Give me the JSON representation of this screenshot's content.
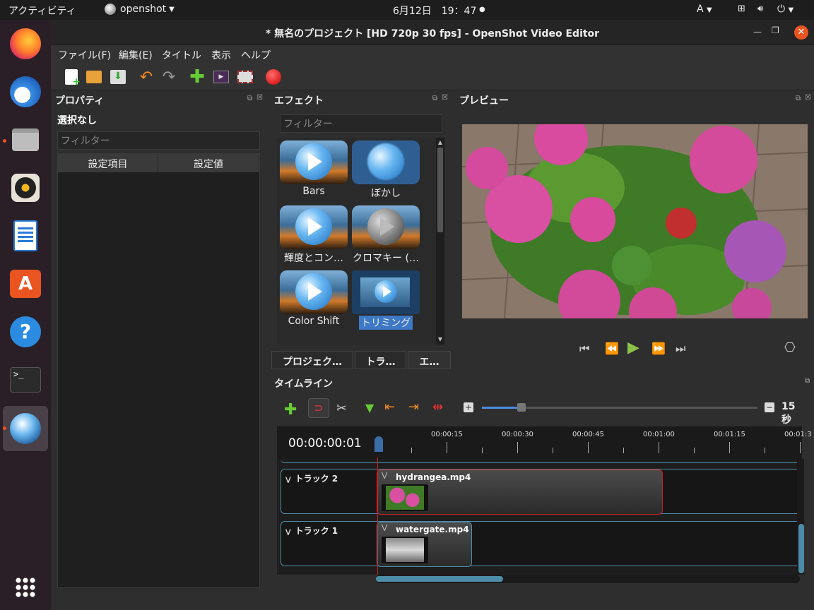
{
  "topbar": {
    "activities": "アクティビティ",
    "app": "openshot",
    "clock": "6月12日　19：47",
    "input_method": "A"
  },
  "window": {
    "title": "* 無名のプロジェクト [HD 720p 30 fps] - OpenShot Video Editor"
  },
  "menu": [
    "ファイル(F)",
    "編集(E)",
    "タイトル",
    "表示",
    "ヘルプ"
  ],
  "properties": {
    "title": "プロパティ",
    "selection": "選択なし",
    "filter_placeholder": "フィルター",
    "col_key": "設定項目",
    "col_value": "設定値"
  },
  "effects": {
    "title": "エフェクト",
    "filter_placeholder": "フィルター",
    "items": [
      "Bars",
      "ぼかし",
      "輝度とコン…",
      "クロマキー (…",
      "Color Shift",
      "トリミング"
    ]
  },
  "tabs": [
    "プロジェク…",
    "トラ…",
    "エ…"
  ],
  "preview": {
    "title": "プレビュー"
  },
  "timeline": {
    "title": "タイムライン",
    "zoom_label": "15 秒",
    "timecode": "00:00:00:01",
    "ruler_labels": [
      "00:00:15",
      "00:00:30",
      "00:00:45",
      "00:01:00",
      "00:01:15",
      "00:01:3"
    ],
    "tracks": [
      {
        "name": "トラック 2",
        "clip": "hydrangea.mp4"
      },
      {
        "name": "トラック 1",
        "clip": "watergate.mp4"
      }
    ]
  },
  "colors": {
    "accent": "#e95420",
    "selected_clip": "#d02020",
    "clip_border": "#4d8ca8"
  }
}
